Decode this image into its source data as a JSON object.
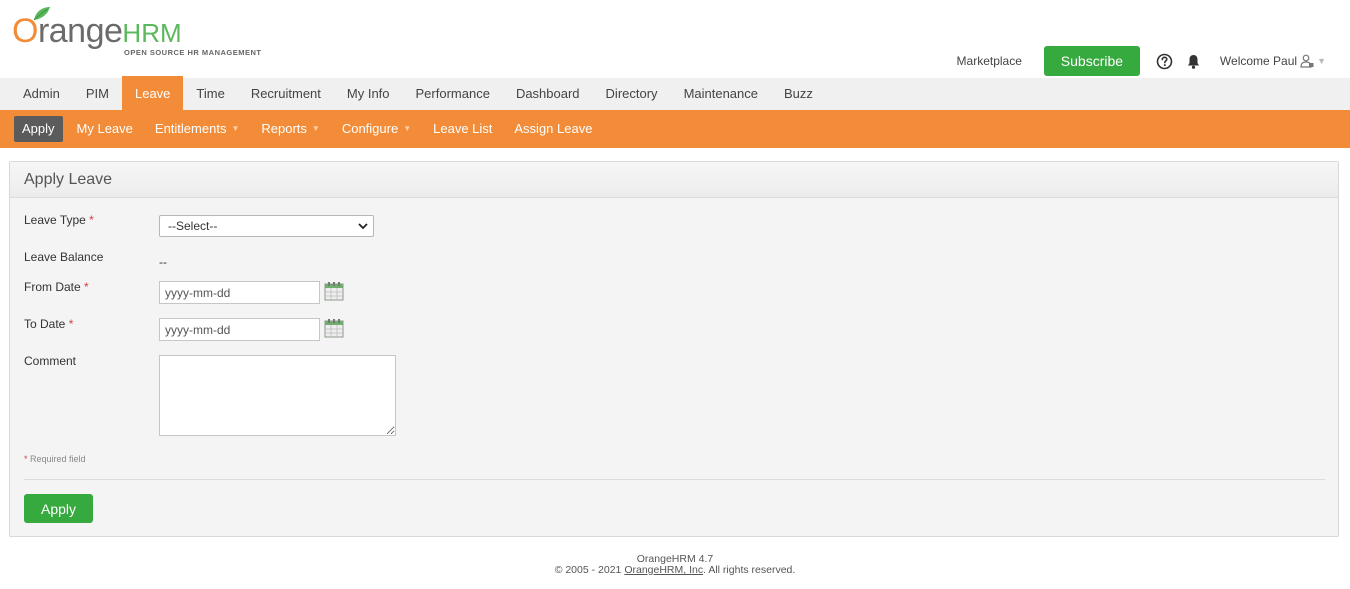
{
  "brand": {
    "logo_o": "O",
    "logo_range": "range",
    "logo_hrm": "HRM",
    "logo_tagline": "OPEN SOURCE HR MANAGEMENT",
    "colors": {
      "orange": "#f28c38",
      "green": "#36a93f",
      "dark": "#5b5b5b"
    }
  },
  "topbar": {
    "marketplace": "Marketplace",
    "subscribe": "Subscribe",
    "help_icon": "question-circle-icon",
    "bell_icon": "bell-icon",
    "welcome": "Welcome Paul",
    "user_icon": "user-lock-icon"
  },
  "main_menu": [
    {
      "label": "Admin",
      "active": false
    },
    {
      "label": "PIM",
      "active": false
    },
    {
      "label": "Leave",
      "active": true
    },
    {
      "label": "Time",
      "active": false
    },
    {
      "label": "Recruitment",
      "active": false
    },
    {
      "label": "My Info",
      "active": false
    },
    {
      "label": "Performance",
      "active": false
    },
    {
      "label": "Dashboard",
      "active": false
    },
    {
      "label": "Directory",
      "active": false
    },
    {
      "label": "Maintenance",
      "active": false
    },
    {
      "label": "Buzz",
      "active": false
    }
  ],
  "sub_menu": [
    {
      "label": "Apply",
      "active": true,
      "dropdown": false
    },
    {
      "label": "My Leave",
      "active": false,
      "dropdown": false
    },
    {
      "label": "Entitlements",
      "active": false,
      "dropdown": true
    },
    {
      "label": "Reports",
      "active": false,
      "dropdown": true
    },
    {
      "label": "Configure",
      "active": false,
      "dropdown": true
    },
    {
      "label": "Leave List",
      "active": false,
      "dropdown": false
    },
    {
      "label": "Assign Leave",
      "active": false,
      "dropdown": false
    }
  ],
  "form": {
    "title": "Apply Leave",
    "leave_type_label": "Leave Type",
    "leave_type_value": "--Select--",
    "leave_balance_label": "Leave Balance",
    "leave_balance_value": "--",
    "from_date_label": "From Date",
    "from_date_value": "yyyy-mm-dd",
    "to_date_label": "To Date",
    "to_date_value": "yyyy-mm-dd",
    "comment_label": "Comment",
    "comment_value": "",
    "required_star": "*",
    "required_note": "Required field",
    "apply_button": "Apply",
    "calendar_icon": "calendar-icon"
  },
  "footer": {
    "version": "OrangeHRM 4.7",
    "copyright_prefix": "© 2005 - 2021 ",
    "company_link": "OrangeHRM, Inc",
    "copyright_suffix": ". All rights reserved."
  }
}
